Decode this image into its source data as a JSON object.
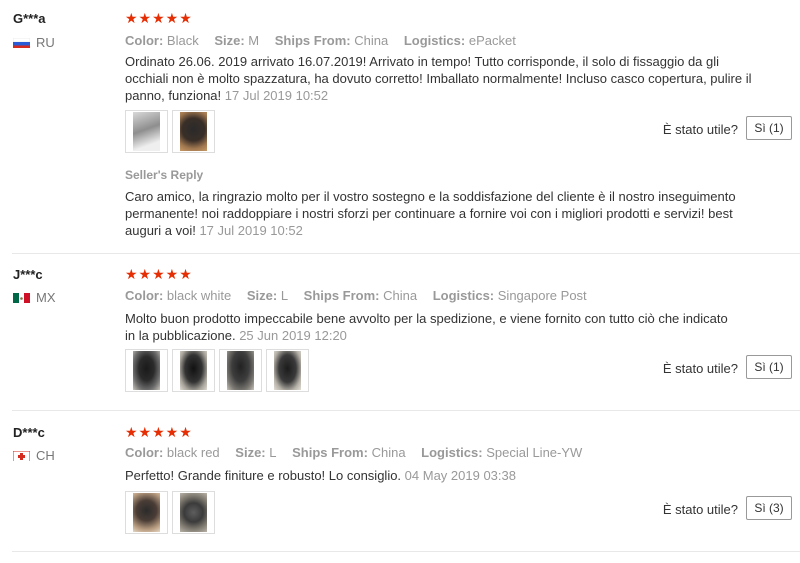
{
  "reviews": [
    {
      "user": "G***a",
      "country": "RU",
      "stars": "★★★★★",
      "color_label": "Color:",
      "color": "Black",
      "size_label": "Size:",
      "size": "M",
      "ships_label": "Ships From:",
      "ships": "China",
      "logistics_label": "Logistics:",
      "logistics": "ePacket",
      "text": "Ordinato 26.06. 2019 arrivato 16.07.2019! Arrivato in tempo! Tutto corrisponde, il solo di fissaggio da gli occhiali non è molto spazzatura, ha dovuto corretto! Imballato normalmente! Incluso casco copertura, pulire il panno, funziona!",
      "date": "17 Jul 2019 10:52",
      "useful_label": "È stato utile?",
      "helpful_button": "Sì (1)",
      "reply_label": "Seller's Reply",
      "reply_text": "Caro amico, la ringrazio molto per il vostro sostegno e la soddisfazione del cliente è il nostro inseguimento permanente! noi raddoppiare i nostri sforzi per continuare a fornire voi con i migliori prodotti e servizi! best auguri a voi!",
      "reply_date": "17 Jul 2019 10:52"
    },
    {
      "user": "J***c",
      "country": "MX",
      "stars": "★★★★★",
      "color_label": "Color:",
      "color": "black white",
      "size_label": "Size:",
      "size": "L",
      "ships_label": "Ships From:",
      "ships": "China",
      "logistics_label": "Logistics:",
      "logistics": "Singapore Post",
      "text": "Molto buon prodotto impeccabile bene avvolto per la spedizione, e viene fornito con tutto ciò che indicato in la pubblicazione.",
      "date": "25 Jun 2019 12:20",
      "useful_label": "È stato utile?",
      "helpful_button": "Sì (1)"
    },
    {
      "user": "D***c",
      "country": "CH",
      "stars": "★★★★★",
      "color_label": "Color:",
      "color": "black red",
      "size_label": "Size:",
      "size": "L",
      "ships_label": "Ships From:",
      "ships": "China",
      "logistics_label": "Logistics:",
      "logistics": "Special Line-YW",
      "text": "Perfetto! Grande finiture e robusto! Lo consiglio.",
      "date": "04 May 2019 03:38",
      "useful_label": "È stato utile?",
      "helpful_button": "Sì (3)"
    }
  ],
  "colors": {
    "star": "#e62e04",
    "muted": "#999999",
    "border": "#e8e8e8"
  }
}
